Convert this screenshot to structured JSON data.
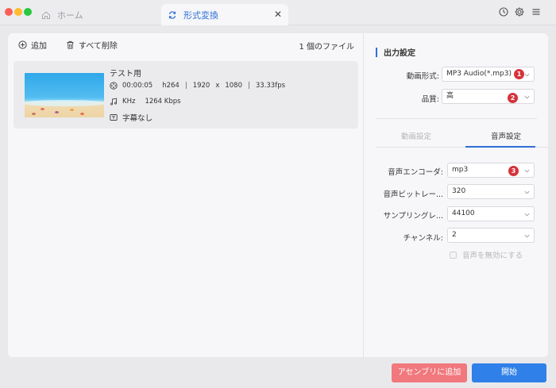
{
  "titlebar": {
    "tabs": [
      {
        "label": "ホーム",
        "icon": "home-icon"
      },
      {
        "label": "形式変換",
        "icon": "refresh-icon",
        "active": true
      }
    ],
    "close_glyph": "✕",
    "icons": [
      "history-icon",
      "settings-icon",
      "menu-icon"
    ]
  },
  "toolbar": {
    "add_label": "追加",
    "delete_all_label": "すべて削除",
    "file_count": "1 個のファイル"
  },
  "file": {
    "name": "テスト用",
    "duration": "00:00:05",
    "codec": "h264",
    "width": "1920",
    "x": "x",
    "height": "1080",
    "fps": "33.33fps",
    "audio_khz": "KHz",
    "audio_bitrate": "1264 Kbps",
    "subtitle": "字幕なし"
  },
  "output": {
    "title": "出力設定",
    "format_label": "動画形式:",
    "format_value": "MP3 Audio(*.mp3)",
    "quality_label": "品質:",
    "quality_value": "高",
    "subtabs": {
      "video": "動画設定",
      "audio": "音声設定"
    },
    "encoder_label": "音声エンコーダ:",
    "encoder_value": "mp3",
    "bitrate_label": "音声ビットレー...",
    "bitrate_value": "320",
    "samplerate_label": "サンプリングレ...",
    "samplerate_value": "44100",
    "channel_label": "チャンネル:",
    "channel_value": "2",
    "disable_audio_label": "音声を無効にする"
  },
  "badges": [
    "1",
    "2",
    "3"
  ],
  "buttons": {
    "assembly": "アセンブリに追加",
    "start": "開始"
  },
  "colors": {
    "accent": "#2f6fd6",
    "start_button": "#2f80e8",
    "assembly_button": "#f1787d",
    "badge": "#d6333a"
  }
}
